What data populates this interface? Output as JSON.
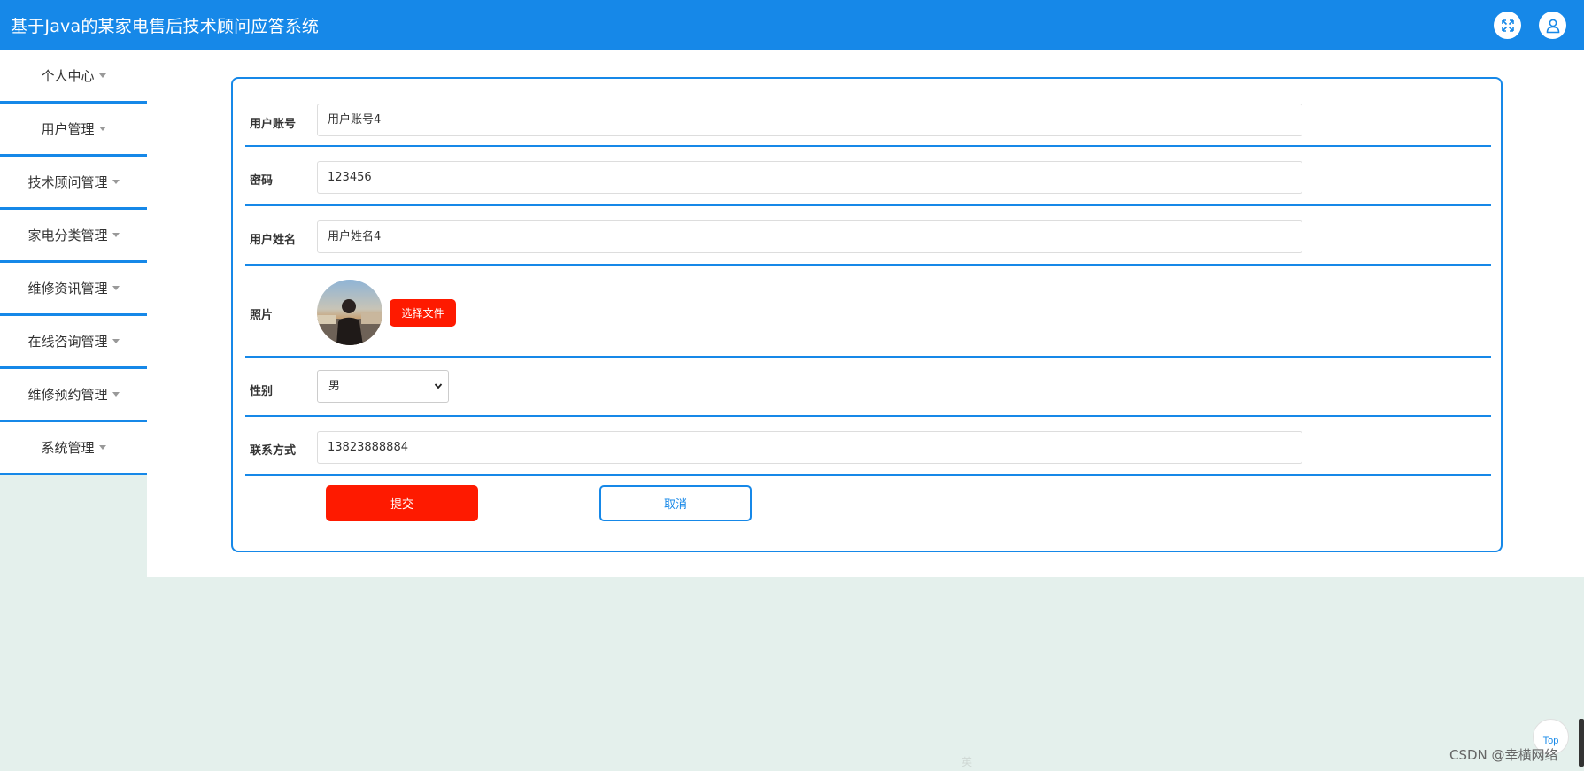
{
  "app": {
    "title": "基于Java的某家电售后技术顾问应答系统"
  },
  "topbar": {
    "fullscreen_icon": "expand-icon",
    "user_icon": "user-icon",
    "color": "#1688e8"
  },
  "sidebar": {
    "items": [
      {
        "label": "个人中心"
      },
      {
        "label": "用户管理"
      },
      {
        "label": "技术顾问管理"
      },
      {
        "label": "家电分类管理"
      },
      {
        "label": "维修资讯管理"
      },
      {
        "label": "在线咨询管理"
      },
      {
        "label": "维修预约管理"
      },
      {
        "label": "系统管理"
      }
    ]
  },
  "form": {
    "account": {
      "label": "用户账号",
      "value": "用户账号4"
    },
    "password": {
      "label": "密码",
      "value": "123456"
    },
    "name": {
      "label": "用户姓名",
      "value": "用户姓名4"
    },
    "photo": {
      "label": "照片",
      "button": "选择文件"
    },
    "gender": {
      "label": "性别",
      "selected": "男"
    },
    "contact": {
      "label": "联系方式",
      "value": "13823888884"
    },
    "submit": "提交",
    "cancel": "取消"
  },
  "footer": {
    "top_button": "Top",
    "watermark": "CSDN @幸横网络",
    "ime_bar": "英"
  },
  "colors": {
    "accent": "#1688e8",
    "danger": "#fe1a00",
    "background": "#e4f0ec"
  }
}
